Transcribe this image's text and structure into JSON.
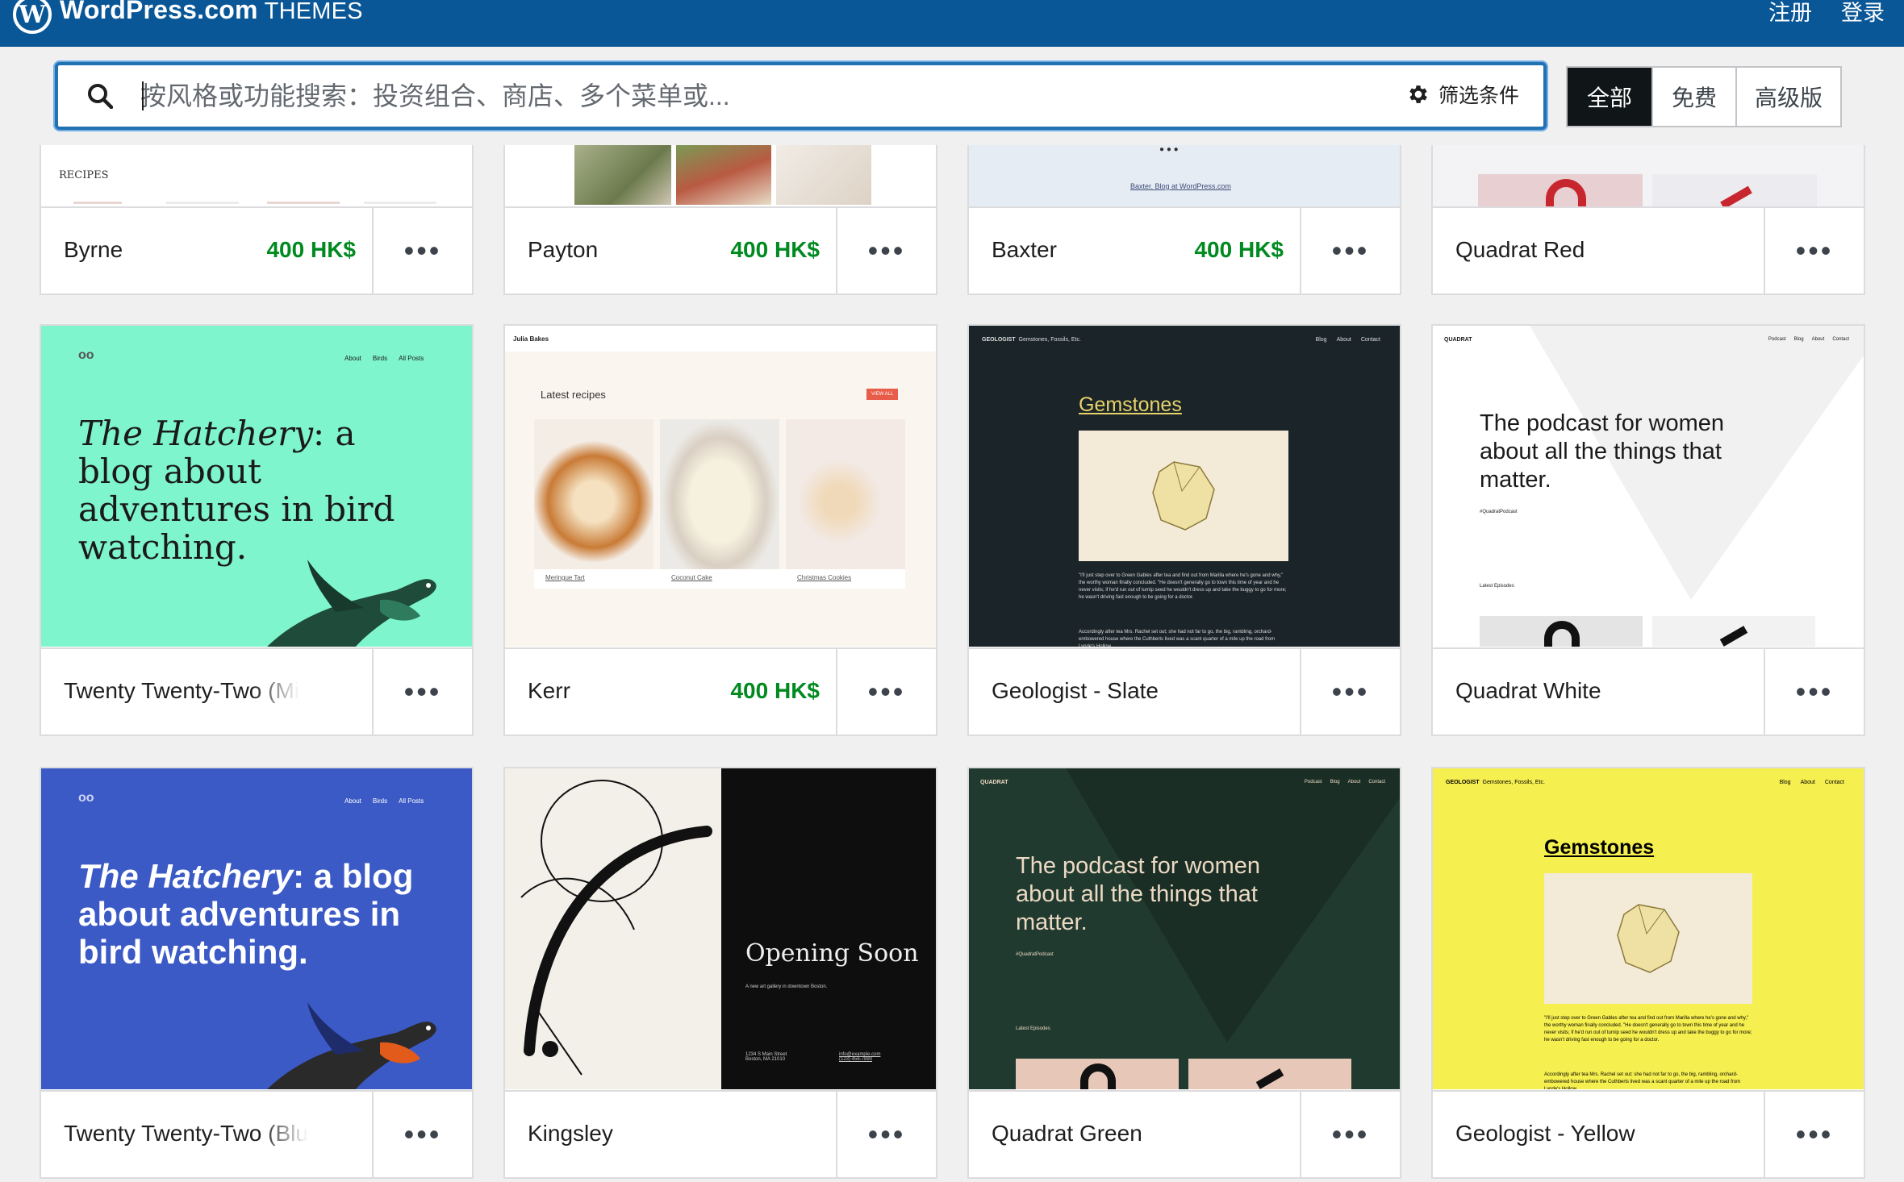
{
  "header": {
    "logo_letter": "W",
    "brand": "WordPress.com",
    "section": "THEMES",
    "signup": "注册",
    "login": "登录"
  },
  "search": {
    "placeholder": "按风格或功能搜索：投资组合、商店、多个菜单或...",
    "filter_label": "筛选条件"
  },
  "tier_options": [
    "全部",
    "免费",
    "高级版"
  ],
  "colors": {
    "header_bg": "#0a5797",
    "price": "#008a20",
    "active_tab": "#101517",
    "focus": "#2271b1"
  },
  "themes": [
    {
      "name": "Byrne",
      "price": "400 HK$"
    },
    {
      "name": "Payton",
      "price": "400 HK$"
    },
    {
      "name": "Baxter",
      "price": "400 HK$"
    },
    {
      "name": "Quadrat Red",
      "price": ""
    },
    {
      "name": "Twenty Twenty-Two (Mi",
      "price": ""
    },
    {
      "name": "Kerr",
      "price": "400 HK$"
    },
    {
      "name": "Geologist - Slate",
      "price": ""
    },
    {
      "name": "Quadrat White",
      "price": ""
    },
    {
      "name": "Twenty Twenty-Two (Blu",
      "price": ""
    },
    {
      "name": "Kingsley",
      "price": ""
    },
    {
      "name": "Quadrat Green",
      "price": ""
    },
    {
      "name": "Geologist - Yellow",
      "price": ""
    }
  ],
  "more_label": "•••",
  "previews": {
    "byrne_label": "RECIPES",
    "baxter_footer": "Baxter. Blog at WordPress.com",
    "hatchery_nav": [
      "About",
      "Birds",
      "All Posts"
    ],
    "hatchery_title_italic": "The Hatchery",
    "hatchery_title_rest": ": a blog about adventures in bird watching.",
    "kerr_site": "Julia Bakes",
    "kerr_heading": "Latest recipes",
    "kerr_view_all": "VIEW ALL",
    "kerr_items": [
      "Meringue Tart",
      "Coconut Cake",
      "Christmas Cookies"
    ],
    "geologist_site": "GEOLOGIST",
    "geologist_tagline": "Gemstones, Fossils, Etc.",
    "geologist_nav": [
      "Blog",
      "About",
      "Contact"
    ],
    "geologist_heading": "Gemstones",
    "geologist_body": "\"I'll just step over to Green Gables after tea and find out from Marilla where he's gone and why,\" the worthy woman finally concluded. \"He doesn't generally go to town this time of year and he never visits; if he'd run out of turnip seed he wouldn't dress up and take the buggy to go for more; he wasn't driving fast enough to be going for a doctor.",
    "geologist_body2": "Accordingly after tea Mrs. Rachel set out; she had not far to go, the big, rambling, orchard-embowered house where the Cuthberts lived was a scant quarter of a mile up the road from Lynde's Hollow.",
    "quadrat_site": "QUADRAT",
    "quadrat_nav": [
      "Podcast",
      "Blog",
      "About",
      "Contact"
    ],
    "quadrat_title": "The podcast for women about all the things that matter.",
    "quadrat_tag": "#QuadratPodcast",
    "quadrat_episodes": "Latest Episodes",
    "kingsley_title": "Opening Soon",
    "kingsley_sub": "A new art gallery in downtown Boston.",
    "kingsley_addr": "1234 S Main Street\nBoston, MA 21010",
    "kingsley_contact": "info@example.com\n(123) 456-7890"
  }
}
